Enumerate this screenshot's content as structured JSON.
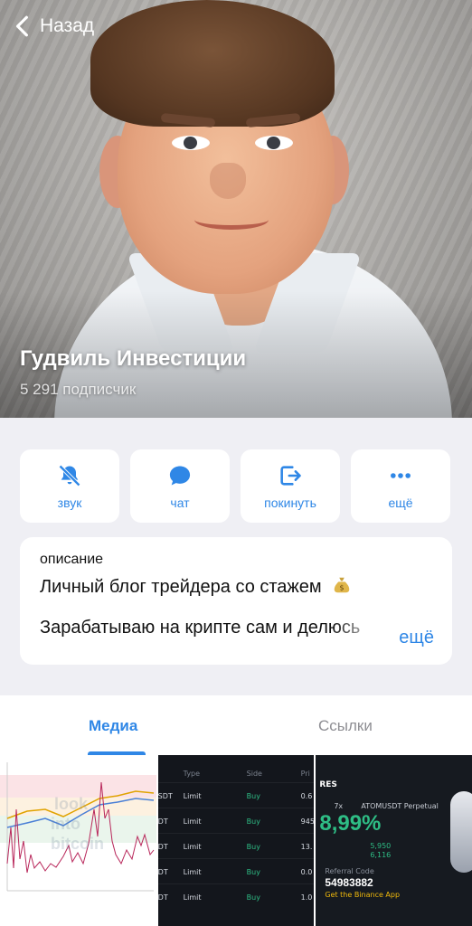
{
  "nav": {
    "back_label": "Назад"
  },
  "channel": {
    "title": "Гудвиль Инвестиции",
    "subscribers": "5 291 подписчик"
  },
  "actions": [
    {
      "label": "звук",
      "icon": "bell-muted-icon"
    },
    {
      "label": "чат",
      "icon": "chat-bubble-icon"
    },
    {
      "label": "покинуть",
      "icon": "leave-icon"
    },
    {
      "label": "ещё",
      "icon": "more-dots-icon"
    }
  ],
  "description": {
    "label": "описание",
    "line1": "Личный блог трейдера со стажем",
    "line2": "Зарабатываю на крипте сам и делюсь",
    "more": "ещё"
  },
  "tabs": [
    {
      "label": "Медиа",
      "active": true
    },
    {
      "label": "Ссылки",
      "active": false
    }
  ],
  "media": {
    "cell2": {
      "headers": [
        "Type",
        "Side",
        "Pri"
      ],
      "rows": [
        {
          "sym": "SDT",
          "type": "Limit",
          "side": "Buy",
          "price": "0.6"
        },
        {
          "sym": "DT",
          "type": "Limit",
          "side": "Buy",
          "price": "945"
        },
        {
          "sym": "DT",
          "type": "Limit",
          "side": "Buy",
          "price": "13."
        },
        {
          "sym": "DT",
          "type": "Limit",
          "side": "Buy",
          "price": "0.0"
        },
        {
          "sym": "DT",
          "type": "Limit",
          "side": "Buy",
          "price": "1.0"
        }
      ]
    },
    "cell3": {
      "header": "RES",
      "leverage": "7x",
      "pair": "ATOMUSDT Perpetual",
      "percent": "8,99%",
      "price1": "5,950",
      "price2": "6,116",
      "ref_label": "Referral Code",
      "ref_code": "54983882",
      "app_text": "Get the Binance App"
    }
  },
  "colors": {
    "accent": "#2f87e6",
    "buy_green": "#2ebd85"
  }
}
